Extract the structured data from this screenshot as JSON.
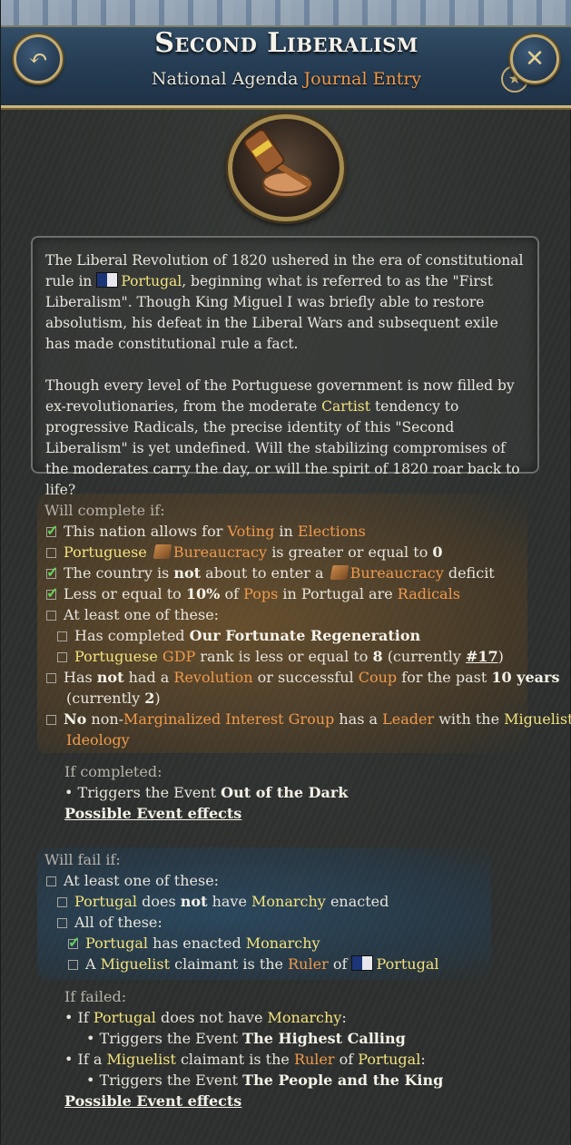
{
  "header": {
    "title": "Second Liberalism",
    "subtitle_part1": "National Agenda",
    "subtitle_part2": "Journal Entry",
    "back_icon": "undo-arrow-icon",
    "close_icon": "close-x-icon",
    "star_icon": "star-icon"
  },
  "emblem": {
    "icon": "gavel-icon"
  },
  "description": {
    "p1_a": "The Liberal Revolution of 1820 ushered in the era of constitutional rule in",
    "p1_country": "Portugal",
    "p1_b": ", beginning what is referred to as the \"First Liberalism\". Though King Miguel I was briefly able to restore absolutism, his defeat in the Liberal Wars and subsequent exile has made constitutional rule a fact.",
    "p2_a": "Though every level of the Portuguese government is now filled by ex-revolutionaries, from the moderate",
    "p2_cartist": "Cartist",
    "p2_b": "tendency to progressive Radicals, the precise identity of this \"Second Liberalism\" is yet undefined. Will the stabilizing compromises of the moderates carry the day, or will the spirit of 1820 roar back to life?"
  },
  "complete": {
    "heading": "Will complete if:",
    "c1": {
      "a": "This nation allows for",
      "voting": "Voting",
      "in": "in",
      "elections": "Elections"
    },
    "c2": {
      "portuguese": "Portuguese",
      "bureaucracy": "Bureaucracy",
      "b": "is greater or equal to",
      "value": "0"
    },
    "c3": {
      "a": "The country is",
      "not": "not",
      "b": "about to enter a",
      "bureaucracy": "Bureaucracy",
      "c": "deficit"
    },
    "c4": {
      "a": "Less or equal to",
      "pct": "10%",
      "b": "of",
      "pops": "Pops",
      "c": "in Portugal are",
      "radicals": "Radicals"
    },
    "c5": "At least one of these:",
    "c5a": {
      "a": "Has completed",
      "name": "Our Fortunate Regeneration"
    },
    "c5b": {
      "portuguese": "Portuguese",
      "gdp": "GDP",
      "a": "rank is less or equal to",
      "rank": "8",
      "b": "(currently",
      "current": "#17",
      "c": ")"
    },
    "c6": {
      "a": "Has",
      "not": "not",
      "b": "had a",
      "revolution": "Revolution",
      "c": "or successful",
      "coup": "Coup",
      "d": "for the past",
      "years": "10 years",
      "e": "(currently",
      "current": "2",
      "f": ")"
    },
    "c7": {
      "no": "No",
      "a": "non-",
      "mig": "Marginalized Interest Group",
      "b": "has a",
      "leader": "Leader",
      "c": "with the",
      "miguelist": "Miguelist",
      "ideology": "Ideology"
    },
    "checked": [
      true,
      false,
      true,
      true,
      false,
      false,
      false,
      false,
      false
    ]
  },
  "on_complete": {
    "heading": "If completed:",
    "bullet_a": "• Triggers the Event",
    "event": "Out of the Dark",
    "effects_link": "Possible Event effects"
  },
  "fail": {
    "heading": "Will fail if:",
    "f1": "At least one of these:",
    "f1a": {
      "portugal": "Portugal",
      "a": "does",
      "not": "not",
      "b": "have",
      "monarchy": "Monarchy",
      "c": "enacted"
    },
    "f1b": "All of these:",
    "f1b1": {
      "portugal": "Portugal",
      "a": "has enacted",
      "monarchy": "Monarchy"
    },
    "f1b2": {
      "a": "A",
      "miguelist": "Miguelist",
      "b": "claimant is the",
      "ruler": "Ruler",
      "c": "of",
      "portugal": "Portugal"
    },
    "checked": [
      false,
      false,
      false,
      true,
      false
    ]
  },
  "on_fail": {
    "heading": "If failed:",
    "b1": {
      "a": "• If",
      "portugal": "Portugal",
      "b": "does not have",
      "monarchy": "Monarchy",
      "c": ":"
    },
    "b1_event_a": "• Triggers the Event",
    "b1_event": "The Highest Calling",
    "b2": {
      "a": "• If a",
      "miguelist": "Miguelist",
      "b": "claimant is the",
      "ruler": "Ruler",
      "c": "of",
      "portugal": "Portugal",
      "d": ":"
    },
    "b2_event_a": "• Triggers the Event",
    "b2_event": "The People and the King",
    "effects_link": "Possible Event effects"
  },
  "colors": {
    "concept_orange": "#f09a4c",
    "concept_yellow": "#f3e27e",
    "check_green": "#66d45a"
  }
}
